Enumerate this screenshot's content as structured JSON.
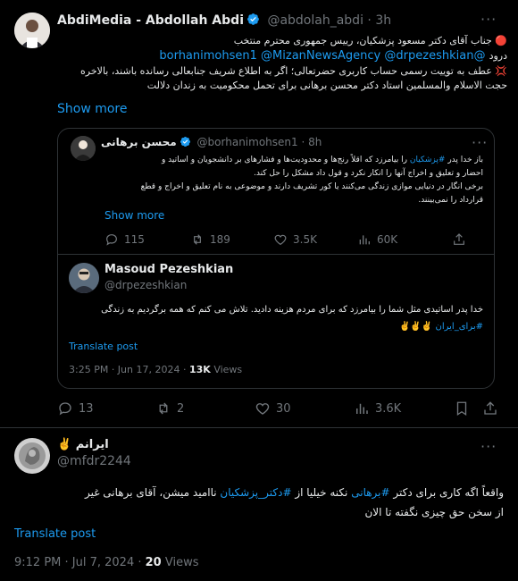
{
  "tweet1": {
    "name": "AbdiMedia - Abdollah Abdi",
    "handle": "@abdolah_abdi",
    "time": "· 3h",
    "line1": "🔴 جناب آقای دکتر مسعود پزشکیان، رییس جمهوری محترم منتخب",
    "line2_prefix": "درود",
    "mention1": "@borhanimohsen1",
    "mention2": "@MizanNewsAgency",
    "mention3": "@drpezeshkian",
    "line3": "💢 عطف به توییت رسمی حساب کاربری حضرتعالی؛ اگر به اطلاع شریف جنابعالی رسانده باشند، بالاخره",
    "line4": "حجت الاسلام والمسلمین استاد دکتر محسن برهانی برای تحمل محکومیت به زندان دلالت",
    "show_more": "Show more",
    "replies": "13",
    "retweets": "2",
    "likes": "30",
    "views": "3.6K"
  },
  "quoted": {
    "name": "محسن برهانی",
    "handle": "@borhanimohsen1",
    "time": "· 8h",
    "line1_prefix": "باز خدا پدر",
    "hashtag": "#پزشکیان",
    "line1_suffix": "را بیامرزد که اقلاً رنج‌ها و محدودیت‌ها و فشارهای بر دانشجویان و اساتید و",
    "line2": "احضار و تعلیق و اخراج آنها را انکار نکرد و قول داد مشکل را حل کند.",
    "line3": "برخی انگار در دنیایی موازی زندگی می‌کنند یا کور تشریف دارند و موضوعی به نام تعلیق و اخراج و قطع",
    "line4": "قرارداد را نمی‌بینند.",
    "show_more": "Show more",
    "replies": "115",
    "retweets": "189",
    "likes": "3.5K",
    "views": "60K"
  },
  "reply": {
    "name": "Masoud Pezeshkian",
    "handle": "@drpezeshkian",
    "line1": "خدا پدر اساتیدی مثل شما را بیامرزد که برای مردم هزینه دادید. تلاش می کنم که همه برگردیم به زندگی",
    "hashtag": "#برای_ایران",
    "emoji": "✌️✌️✌️",
    "translate": "Translate post",
    "time": "3:25 PM · Jun 17, 2024 ·",
    "views_count": "13K",
    "views_label": "Views"
  },
  "tweet2": {
    "name": "ایرانم ✌️",
    "handle": "@mfdr2244",
    "line1_a": "واقعاً اگه کاری برای دکتر",
    "hashtag1": "#برهانی",
    "line1_b": "نکنه خیلیا از",
    "hashtag2": "#دکتر_پزشکیان",
    "line1_c": "ناامید میشن، آقای برهانی غیر",
    "line2": "از سخن حق چیزی نگفته تا الان",
    "translate": "Translate post",
    "time": "9:12 PM · Jul 7, 2024 ·",
    "views_count": "20",
    "views_label": "Views"
  },
  "colors": {
    "accent": "#1d9bf0",
    "muted": "#71767b",
    "border": "#2f3336"
  },
  "icons": [
    "more-icon",
    "verified-icon",
    "reply-icon",
    "retweet-icon",
    "like-icon",
    "views-icon",
    "bookmark-icon",
    "share-icon"
  ]
}
